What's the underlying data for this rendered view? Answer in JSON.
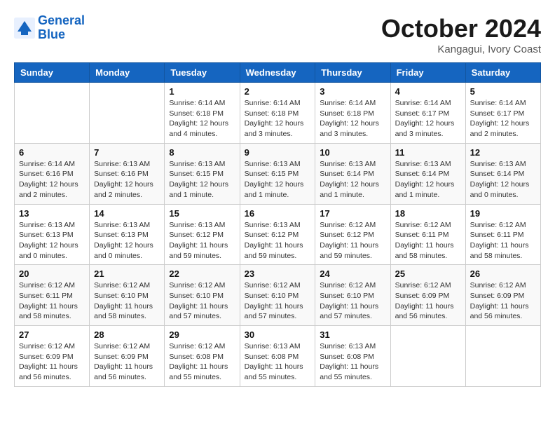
{
  "logo": {
    "line1": "General",
    "line2": "Blue"
  },
  "title": "October 2024",
  "location": "Kangagui, Ivory Coast",
  "days_header": [
    "Sunday",
    "Monday",
    "Tuesday",
    "Wednesday",
    "Thursday",
    "Friday",
    "Saturday"
  ],
  "weeks": [
    [
      {
        "day": "",
        "info": ""
      },
      {
        "day": "",
        "info": ""
      },
      {
        "day": "1",
        "sunrise": "Sunrise: 6:14 AM",
        "sunset": "Sunset: 6:18 PM",
        "daylight": "Daylight: 12 hours and 4 minutes."
      },
      {
        "day": "2",
        "sunrise": "Sunrise: 6:14 AM",
        "sunset": "Sunset: 6:18 PM",
        "daylight": "Daylight: 12 hours and 3 minutes."
      },
      {
        "day": "3",
        "sunrise": "Sunrise: 6:14 AM",
        "sunset": "Sunset: 6:18 PM",
        "daylight": "Daylight: 12 hours and 3 minutes."
      },
      {
        "day": "4",
        "sunrise": "Sunrise: 6:14 AM",
        "sunset": "Sunset: 6:17 PM",
        "daylight": "Daylight: 12 hours and 3 minutes."
      },
      {
        "day": "5",
        "sunrise": "Sunrise: 6:14 AM",
        "sunset": "Sunset: 6:17 PM",
        "daylight": "Daylight: 12 hours and 2 minutes."
      }
    ],
    [
      {
        "day": "6",
        "sunrise": "Sunrise: 6:14 AM",
        "sunset": "Sunset: 6:16 PM",
        "daylight": "Daylight: 12 hours and 2 minutes."
      },
      {
        "day": "7",
        "sunrise": "Sunrise: 6:13 AM",
        "sunset": "Sunset: 6:16 PM",
        "daylight": "Daylight: 12 hours and 2 minutes."
      },
      {
        "day": "8",
        "sunrise": "Sunrise: 6:13 AM",
        "sunset": "Sunset: 6:15 PM",
        "daylight": "Daylight: 12 hours and 1 minute."
      },
      {
        "day": "9",
        "sunrise": "Sunrise: 6:13 AM",
        "sunset": "Sunset: 6:15 PM",
        "daylight": "Daylight: 12 hours and 1 minute."
      },
      {
        "day": "10",
        "sunrise": "Sunrise: 6:13 AM",
        "sunset": "Sunset: 6:14 PM",
        "daylight": "Daylight: 12 hours and 1 minute."
      },
      {
        "day": "11",
        "sunrise": "Sunrise: 6:13 AM",
        "sunset": "Sunset: 6:14 PM",
        "daylight": "Daylight: 12 hours and 1 minute."
      },
      {
        "day": "12",
        "sunrise": "Sunrise: 6:13 AM",
        "sunset": "Sunset: 6:14 PM",
        "daylight": "Daylight: 12 hours and 0 minutes."
      }
    ],
    [
      {
        "day": "13",
        "sunrise": "Sunrise: 6:13 AM",
        "sunset": "Sunset: 6:13 PM",
        "daylight": "Daylight: 12 hours and 0 minutes."
      },
      {
        "day": "14",
        "sunrise": "Sunrise: 6:13 AM",
        "sunset": "Sunset: 6:13 PM",
        "daylight": "Daylight: 12 hours and 0 minutes."
      },
      {
        "day": "15",
        "sunrise": "Sunrise: 6:13 AM",
        "sunset": "Sunset: 6:12 PM",
        "daylight": "Daylight: 11 hours and 59 minutes."
      },
      {
        "day": "16",
        "sunrise": "Sunrise: 6:13 AM",
        "sunset": "Sunset: 6:12 PM",
        "daylight": "Daylight: 11 hours and 59 minutes."
      },
      {
        "day": "17",
        "sunrise": "Sunrise: 6:12 AM",
        "sunset": "Sunset: 6:12 PM",
        "daylight": "Daylight: 11 hours and 59 minutes."
      },
      {
        "day": "18",
        "sunrise": "Sunrise: 6:12 AM",
        "sunset": "Sunset: 6:11 PM",
        "daylight": "Daylight: 11 hours and 58 minutes."
      },
      {
        "day": "19",
        "sunrise": "Sunrise: 6:12 AM",
        "sunset": "Sunset: 6:11 PM",
        "daylight": "Daylight: 11 hours and 58 minutes."
      }
    ],
    [
      {
        "day": "20",
        "sunrise": "Sunrise: 6:12 AM",
        "sunset": "Sunset: 6:11 PM",
        "daylight": "Daylight: 11 hours and 58 minutes."
      },
      {
        "day": "21",
        "sunrise": "Sunrise: 6:12 AM",
        "sunset": "Sunset: 6:10 PM",
        "daylight": "Daylight: 11 hours and 58 minutes."
      },
      {
        "day": "22",
        "sunrise": "Sunrise: 6:12 AM",
        "sunset": "Sunset: 6:10 PM",
        "daylight": "Daylight: 11 hours and 57 minutes."
      },
      {
        "day": "23",
        "sunrise": "Sunrise: 6:12 AM",
        "sunset": "Sunset: 6:10 PM",
        "daylight": "Daylight: 11 hours and 57 minutes."
      },
      {
        "day": "24",
        "sunrise": "Sunrise: 6:12 AM",
        "sunset": "Sunset: 6:10 PM",
        "daylight": "Daylight: 11 hours and 57 minutes."
      },
      {
        "day": "25",
        "sunrise": "Sunrise: 6:12 AM",
        "sunset": "Sunset: 6:09 PM",
        "daylight": "Daylight: 11 hours and 56 minutes."
      },
      {
        "day": "26",
        "sunrise": "Sunrise: 6:12 AM",
        "sunset": "Sunset: 6:09 PM",
        "daylight": "Daylight: 11 hours and 56 minutes."
      }
    ],
    [
      {
        "day": "27",
        "sunrise": "Sunrise: 6:12 AM",
        "sunset": "Sunset: 6:09 PM",
        "daylight": "Daylight: 11 hours and 56 minutes."
      },
      {
        "day": "28",
        "sunrise": "Sunrise: 6:12 AM",
        "sunset": "Sunset: 6:09 PM",
        "daylight": "Daylight: 11 hours and 56 minutes."
      },
      {
        "day": "29",
        "sunrise": "Sunrise: 6:12 AM",
        "sunset": "Sunset: 6:08 PM",
        "daylight": "Daylight: 11 hours and 55 minutes."
      },
      {
        "day": "30",
        "sunrise": "Sunrise: 6:13 AM",
        "sunset": "Sunset: 6:08 PM",
        "daylight": "Daylight: 11 hours and 55 minutes."
      },
      {
        "day": "31",
        "sunrise": "Sunrise: 6:13 AM",
        "sunset": "Sunset: 6:08 PM",
        "daylight": "Daylight: 11 hours and 55 minutes."
      },
      {
        "day": "",
        "info": ""
      },
      {
        "day": "",
        "info": ""
      }
    ]
  ]
}
